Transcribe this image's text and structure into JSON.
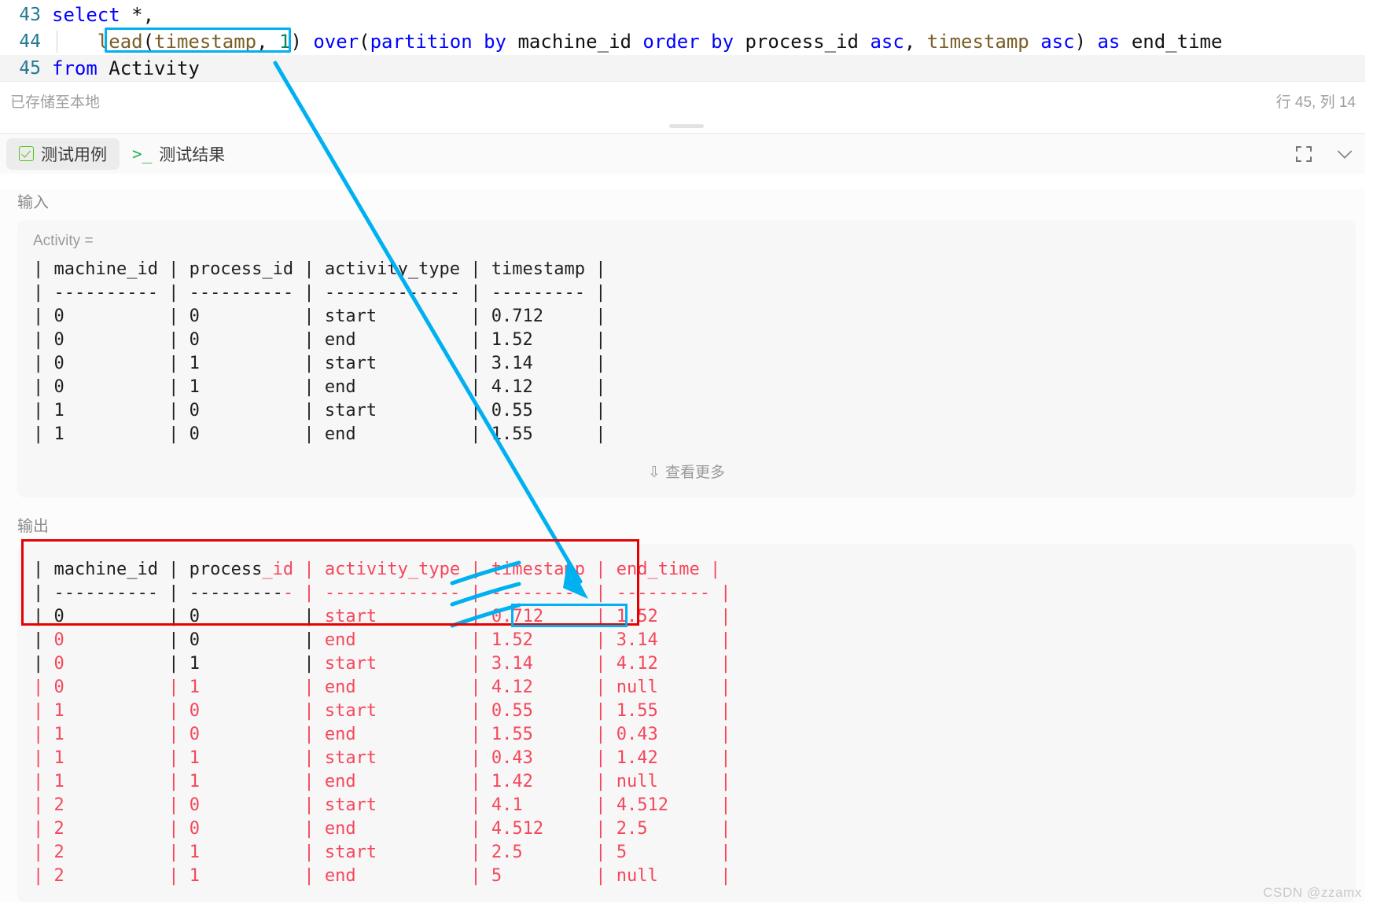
{
  "editor": {
    "lines": [
      {
        "number": "43",
        "tokens": [
          {
            "t": "select",
            "c": "kw"
          },
          {
            "t": " ",
            "c": "pun"
          },
          {
            "t": "*",
            "c": "pun"
          },
          {
            "t": ",",
            "c": "pun"
          }
        ]
      },
      {
        "number": "44",
        "tokens": [
          {
            "t": "    ",
            "c": "pun"
          },
          {
            "t": "lead",
            "c": "fn"
          },
          {
            "t": "(",
            "c": "pun"
          },
          {
            "t": "timestamp",
            "c": "fn"
          },
          {
            "t": ", ",
            "c": "pun"
          },
          {
            "t": "1",
            "c": "num"
          },
          {
            "t": ")",
            "c": "pun"
          },
          {
            "t": " ",
            "c": "pun"
          },
          {
            "t": "over",
            "c": "kw"
          },
          {
            "t": "(",
            "c": "pun"
          },
          {
            "t": "partition",
            "c": "kw"
          },
          {
            "t": " ",
            "c": "pun"
          },
          {
            "t": "by",
            "c": "kw"
          },
          {
            "t": " ",
            "c": "pun"
          },
          {
            "t": "machine_id",
            "c": "id"
          },
          {
            "t": " ",
            "c": "pun"
          },
          {
            "t": "order",
            "c": "kw"
          },
          {
            "t": " ",
            "c": "pun"
          },
          {
            "t": "by",
            "c": "kw"
          },
          {
            "t": " ",
            "c": "pun"
          },
          {
            "t": "process_id",
            "c": "id"
          },
          {
            "t": " ",
            "c": "pun"
          },
          {
            "t": "asc",
            "c": "kw"
          },
          {
            "t": ", ",
            "c": "pun"
          },
          {
            "t": "timestamp",
            "c": "fn"
          },
          {
            "t": " ",
            "c": "pun"
          },
          {
            "t": "asc",
            "c": "kw"
          },
          {
            "t": ")",
            "c": "pun"
          },
          {
            "t": " ",
            "c": "pun"
          },
          {
            "t": "as",
            "c": "kw"
          },
          {
            "t": " ",
            "c": "pun"
          },
          {
            "t": "end_time",
            "c": "id"
          }
        ]
      },
      {
        "number": "45",
        "tokens": [
          {
            "t": "from",
            "c": "kw"
          },
          {
            "t": " ",
            "c": "pun"
          },
          {
            "t": "Activity",
            "c": "id"
          }
        ]
      }
    ]
  },
  "status": {
    "saved_text": "已存储至本地",
    "cursor_text": "行 45, 列 14"
  },
  "tabs": {
    "testcase": {
      "label": "测试用例",
      "icon": "checkbox-check-icon"
    },
    "testresult": {
      "label": "测试结果",
      "icon": "terminal-prompt-icon",
      "prompt": ">_"
    },
    "expand_icon": "fullscreen-expand-icon",
    "collapse_icon": "chevron-down-icon"
  },
  "input": {
    "label": "输入",
    "caption": "Activity =",
    "table_text": "| machine_id | process_id | activity_type | timestamp |\n| ---------- | ---------- | ------------- | --------- |\n| 0          | 0          | start         | 0.712     |\n| 0          | 0          | end           | 1.52      |\n| 0          | 1          | start         | 3.14      |\n| 0          | 1          | end           | 4.12      |\n| 1          | 0          | start         | 0.55      |\n| 1          | 0          | end           | 1.55      |",
    "view_more": "查看更多",
    "view_more_icon": "chevron-double-down-icon"
  },
  "output": {
    "label": "输出",
    "header_black": "| machine_id | process",
    "header_red": "_id | activity_type | timestamp | end_time |",
    "divider_black": "| ---------- | ---------",
    "divider_red": "- | ------------- | --------- | --------- |",
    "rows": [
      {
        "segments": [
          {
            "t": "| ",
            "c": "black"
          },
          {
            "t": "0",
            "c": "black"
          },
          {
            "t": "          | ",
            "c": "black"
          },
          {
            "t": "0",
            "c": "black"
          },
          {
            "t": "          | ",
            "c": "black"
          },
          {
            "t": "start",
            "c": "red"
          },
          {
            "t": "         | ",
            "c": "red"
          },
          {
            "t": "0.712",
            "c": "red"
          },
          {
            "t": "     | ",
            "c": "red"
          },
          {
            "t": "1.52",
            "c": "red"
          },
          {
            "t": "      |",
            "c": "red"
          }
        ]
      },
      {
        "segments": [
          {
            "t": "| ",
            "c": "black"
          },
          {
            "t": "0",
            "c": "red"
          },
          {
            "t": "          | ",
            "c": "black"
          },
          {
            "t": "0",
            "c": "black"
          },
          {
            "t": "          | ",
            "c": "black"
          },
          {
            "t": "end",
            "c": "red"
          },
          {
            "t": "           | ",
            "c": "red"
          },
          {
            "t": "1.52",
            "c": "red"
          },
          {
            "t": "      | ",
            "c": "red"
          },
          {
            "t": "3.14",
            "c": "red"
          },
          {
            "t": "      |",
            "c": "red"
          }
        ]
      },
      {
        "segments": [
          {
            "t": "| ",
            "c": "black"
          },
          {
            "t": "0",
            "c": "red"
          },
          {
            "t": "          | ",
            "c": "black"
          },
          {
            "t": "1",
            "c": "black"
          },
          {
            "t": "          | ",
            "c": "black"
          },
          {
            "t": "start",
            "c": "red"
          },
          {
            "t": "         | ",
            "c": "red"
          },
          {
            "t": "3.14",
            "c": "red"
          },
          {
            "t": "      | ",
            "c": "red"
          },
          {
            "t": "4.12",
            "c": "red"
          },
          {
            "t": "      |",
            "c": "red"
          }
        ]
      },
      {
        "segments": [
          {
            "t": "| ",
            "c": "red"
          },
          {
            "t": "0",
            "c": "red"
          },
          {
            "t": "          | ",
            "c": "red"
          },
          {
            "t": "1",
            "c": "red"
          },
          {
            "t": "          | ",
            "c": "red"
          },
          {
            "t": "end",
            "c": "red"
          },
          {
            "t": "           | ",
            "c": "red"
          },
          {
            "t": "4.12",
            "c": "red"
          },
          {
            "t": "      | ",
            "c": "red"
          },
          {
            "t": "null",
            "c": "red"
          },
          {
            "t": "      |",
            "c": "red"
          }
        ]
      },
      {
        "segments": [
          {
            "t": "| ",
            "c": "red"
          },
          {
            "t": "1",
            "c": "red"
          },
          {
            "t": "          | ",
            "c": "red"
          },
          {
            "t": "0",
            "c": "red"
          },
          {
            "t": "          | ",
            "c": "red"
          },
          {
            "t": "start",
            "c": "red"
          },
          {
            "t": "         | ",
            "c": "red"
          },
          {
            "t": "0.55",
            "c": "red"
          },
          {
            "t": "      | ",
            "c": "red"
          },
          {
            "t": "1.55",
            "c": "red"
          },
          {
            "t": "      |",
            "c": "red"
          }
        ]
      },
      {
        "segments": [
          {
            "t": "| ",
            "c": "red"
          },
          {
            "t": "1",
            "c": "red"
          },
          {
            "t": "          | ",
            "c": "red"
          },
          {
            "t": "0",
            "c": "red"
          },
          {
            "t": "          | ",
            "c": "red"
          },
          {
            "t": "end",
            "c": "red"
          },
          {
            "t": "           | ",
            "c": "red"
          },
          {
            "t": "1.55",
            "c": "red"
          },
          {
            "t": "      | ",
            "c": "red"
          },
          {
            "t": "0.43",
            "c": "red"
          },
          {
            "t": "      |",
            "c": "red"
          }
        ]
      },
      {
        "segments": [
          {
            "t": "| ",
            "c": "red"
          },
          {
            "t": "1",
            "c": "red"
          },
          {
            "t": "          | ",
            "c": "red"
          },
          {
            "t": "1",
            "c": "red"
          },
          {
            "t": "          | ",
            "c": "red"
          },
          {
            "t": "start",
            "c": "red"
          },
          {
            "t": "         | ",
            "c": "red"
          },
          {
            "t": "0.43",
            "c": "red"
          },
          {
            "t": "      | ",
            "c": "red"
          },
          {
            "t": "1.42",
            "c": "red"
          },
          {
            "t": "      |",
            "c": "red"
          }
        ]
      },
      {
        "segments": [
          {
            "t": "| ",
            "c": "red"
          },
          {
            "t": "1",
            "c": "red"
          },
          {
            "t": "          | ",
            "c": "red"
          },
          {
            "t": "1",
            "c": "red"
          },
          {
            "t": "          | ",
            "c": "red"
          },
          {
            "t": "end",
            "c": "red"
          },
          {
            "t": "           | ",
            "c": "red"
          },
          {
            "t": "1.42",
            "c": "red"
          },
          {
            "t": "      | ",
            "c": "red"
          },
          {
            "t": "null",
            "c": "red"
          },
          {
            "t": "      |",
            "c": "red"
          }
        ]
      },
      {
        "segments": [
          {
            "t": "| ",
            "c": "red"
          },
          {
            "t": "2",
            "c": "red"
          },
          {
            "t": "          | ",
            "c": "red"
          },
          {
            "t": "0",
            "c": "red"
          },
          {
            "t": "          | ",
            "c": "red"
          },
          {
            "t": "start",
            "c": "red"
          },
          {
            "t": "         | ",
            "c": "red"
          },
          {
            "t": "4.1",
            "c": "red"
          },
          {
            "t": "       | ",
            "c": "red"
          },
          {
            "t": "4.512",
            "c": "red"
          },
          {
            "t": "     |",
            "c": "red"
          }
        ]
      },
      {
        "segments": [
          {
            "t": "| ",
            "c": "red"
          },
          {
            "t": "2",
            "c": "red"
          },
          {
            "t": "          | ",
            "c": "red"
          },
          {
            "t": "0",
            "c": "red"
          },
          {
            "t": "          | ",
            "c": "red"
          },
          {
            "t": "end",
            "c": "red"
          },
          {
            "t": "           | ",
            "c": "red"
          },
          {
            "t": "4.512",
            "c": "red"
          },
          {
            "t": "     | ",
            "c": "red"
          },
          {
            "t": "2.5",
            "c": "red"
          },
          {
            "t": "       |",
            "c": "red"
          }
        ]
      },
      {
        "segments": [
          {
            "t": "| ",
            "c": "red"
          },
          {
            "t": "2",
            "c": "red"
          },
          {
            "t": "          | ",
            "c": "red"
          },
          {
            "t": "1",
            "c": "red"
          },
          {
            "t": "          | ",
            "c": "red"
          },
          {
            "t": "start",
            "c": "red"
          },
          {
            "t": "         | ",
            "c": "red"
          },
          {
            "t": "2.5",
            "c": "red"
          },
          {
            "t": "       | ",
            "c": "red"
          },
          {
            "t": "5",
            "c": "red"
          },
          {
            "t": "         |",
            "c": "red"
          }
        ]
      },
      {
        "segments": [
          {
            "t": "| ",
            "c": "red"
          },
          {
            "t": "2",
            "c": "red"
          },
          {
            "t": "          | ",
            "c": "red"
          },
          {
            "t": "1",
            "c": "red"
          },
          {
            "t": "          | ",
            "c": "red"
          },
          {
            "t": "end",
            "c": "red"
          },
          {
            "t": "           | ",
            "c": "red"
          },
          {
            "t": "5",
            "c": "red"
          },
          {
            "t": "         | ",
            "c": "red"
          },
          {
            "t": "null",
            "c": "red"
          },
          {
            "t": "      |",
            "c": "red"
          }
        ]
      }
    ]
  },
  "annotations": {
    "code_highlight_label": "lead(timestamp, 1)",
    "null_highlight_label": "null",
    "arrow_color": "#00b0f0",
    "red_box_color": "#e60000",
    "cyan_box_color": "#00b0f0"
  },
  "watermark": "CSDN @zzamx",
  "colors": {
    "accent_cyan": "#00b0f0",
    "accent_red": "#e60000",
    "diff_red": "#f5475b",
    "keyword_blue": "#0000ff",
    "function_gold": "#795e26",
    "number_green": "#098658",
    "green_icon": "#52c41a"
  }
}
